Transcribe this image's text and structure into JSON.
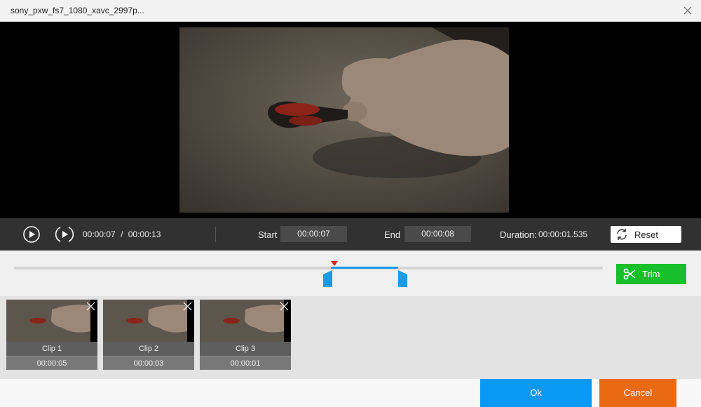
{
  "window": {
    "title": "sony_pxw_fs7_1080_xavc_2997p..."
  },
  "player": {
    "current_time": "00:00:07",
    "separator": "/",
    "total_time": "00:00:13"
  },
  "trim": {
    "start_label": "Start",
    "start_value": "00:00:07",
    "end_label": "End",
    "end_value": "00:00:08",
    "duration_label": "Duration:",
    "duration_value": "00:00:01.535",
    "reset_label": "Reset",
    "trim_label": "Trim"
  },
  "clips": [
    {
      "name": "Clip 1",
      "duration": "00:00:05"
    },
    {
      "name": "Clip 2",
      "duration": "00:00:03"
    },
    {
      "name": "Clip 3",
      "duration": "00:00:01"
    }
  ],
  "footer": {
    "ok_label": "Ok",
    "cancel_label": "Cancel"
  },
  "colors": {
    "accent_blue": "#1a9be8",
    "trim_green": "#17c02b",
    "cancel_orange": "#ea6a13",
    "playhead_red": "#e02020"
  }
}
